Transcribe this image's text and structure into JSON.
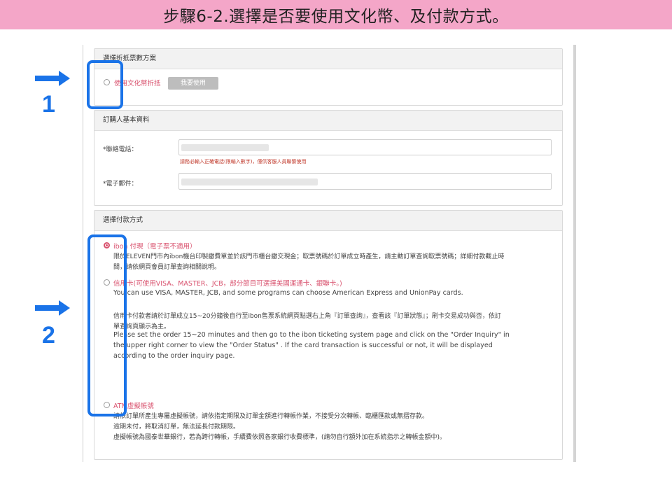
{
  "banner": {
    "title": "步驟6-2.選擇是否要使用文化幣、及付款方式。"
  },
  "discount": {
    "header": "選擇折抵票數方案",
    "option_label": "使用文化幣折抵",
    "button_label": "我要使用"
  },
  "buyer": {
    "header": "訂購人基本資料",
    "phone_label": "*聯絡電話：",
    "phone_hint": "請務必輸入正確電話(限輸入數字)，僅供客服人員聯繫使用",
    "email_label": "*電子郵件："
  },
  "payment": {
    "header": "選擇付款方式",
    "ibon": {
      "label": "ibon 付現（電子票不適用）",
      "desc_line1": "限於ELEVEN門市內ibon機台印製繳費單並於該門市櫃台繳交現金；取票號碼於訂單成立時產生，請主動訂單查詢取票號碼；詳細付款截止時",
      "desc_line2": "間，請依網頁會員訂單查詢相關說明。"
    },
    "credit": {
      "label": "信用卡(可使用VISA、MASTER、JCB，部分節目可選擇美國運通卡、銀聯卡。)",
      "en_line1": "You can use VISA, MASTER, JCB, and some programs can choose American Express and UnionPay cards.",
      "zh_line1": "信用卡付款者請於訂單成立15~20分鐘後自行至ibon售票系統網頁點選右上角『訂單查詢』，查看該『訂單狀態』；刷卡交易成功與否，依訂",
      "zh_line2": "單查詢頁顯示為主。",
      "en_line2": "Please set the order 15~20 minutes and then go to the ibon ticketing system page and click on the  \"Order Inquiry\"  in",
      "en_line3": "the upper right corner to view the  \"Order Status\" . If the card transaction is successful or not, it will be displayed",
      "en_line4": "according to the order inquiry page."
    },
    "atm": {
      "label": "ATM虛擬帳號",
      "desc_line1": "請依訂單所產生專屬虛擬帳號，請依指定期限及訂單金額進行轉帳作業，不接受分次轉帳、臨櫃匯款或無摺存款。",
      "desc_line2": "逾期未付，將取消訂單，無法延長付款期限。",
      "desc_line3": "虛擬帳號為國泰世華銀行，若為跨行轉帳，手續費依照各家銀行收費標準，(請勿自行額外加在系統指示之轉帳金額中)。"
    }
  },
  "annotations": {
    "step1": "1",
    "step2": "2"
  },
  "colors": {
    "banner": "#f4a6c8",
    "accent": "#d9536f",
    "highlight": "#1a73e8"
  }
}
